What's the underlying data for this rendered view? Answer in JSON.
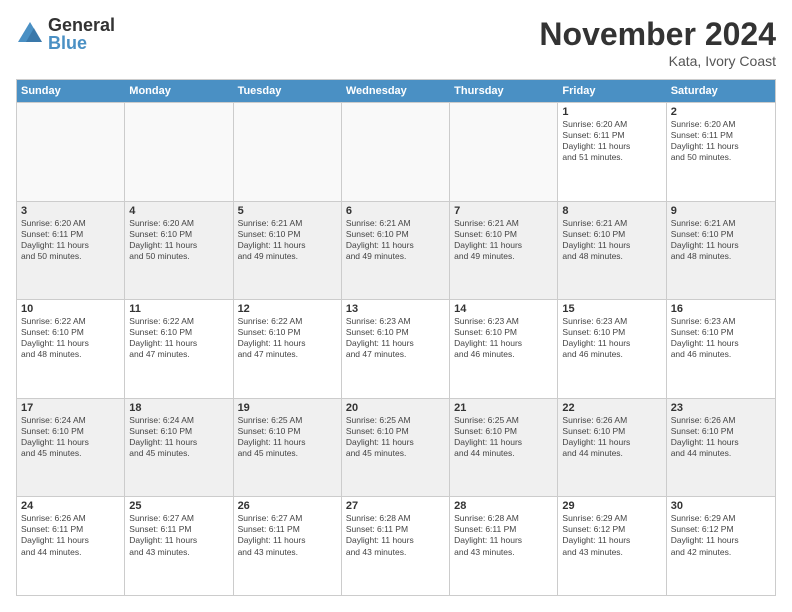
{
  "logo": {
    "general": "General",
    "blue": "Blue"
  },
  "title": "November 2024",
  "location": "Kata, Ivory Coast",
  "days_of_week": [
    "Sunday",
    "Monday",
    "Tuesday",
    "Wednesday",
    "Thursday",
    "Friday",
    "Saturday"
  ],
  "weeks": [
    [
      {
        "day": "",
        "info": "",
        "empty": true
      },
      {
        "day": "",
        "info": "",
        "empty": true
      },
      {
        "day": "",
        "info": "",
        "empty": true
      },
      {
        "day": "",
        "info": "",
        "empty": true
      },
      {
        "day": "",
        "info": "",
        "empty": true
      },
      {
        "day": "1",
        "info": "Sunrise: 6:20 AM\nSunset: 6:11 PM\nDaylight: 11 hours\nand 51 minutes."
      },
      {
        "day": "2",
        "info": "Sunrise: 6:20 AM\nSunset: 6:11 PM\nDaylight: 11 hours\nand 50 minutes."
      }
    ],
    [
      {
        "day": "3",
        "info": "Sunrise: 6:20 AM\nSunset: 6:11 PM\nDaylight: 11 hours\nand 50 minutes.",
        "shaded": true
      },
      {
        "day": "4",
        "info": "Sunrise: 6:20 AM\nSunset: 6:10 PM\nDaylight: 11 hours\nand 50 minutes.",
        "shaded": true
      },
      {
        "day": "5",
        "info": "Sunrise: 6:21 AM\nSunset: 6:10 PM\nDaylight: 11 hours\nand 49 minutes.",
        "shaded": true
      },
      {
        "day": "6",
        "info": "Sunrise: 6:21 AM\nSunset: 6:10 PM\nDaylight: 11 hours\nand 49 minutes.",
        "shaded": true
      },
      {
        "day": "7",
        "info": "Sunrise: 6:21 AM\nSunset: 6:10 PM\nDaylight: 11 hours\nand 49 minutes.",
        "shaded": true
      },
      {
        "day": "8",
        "info": "Sunrise: 6:21 AM\nSunset: 6:10 PM\nDaylight: 11 hours\nand 48 minutes.",
        "shaded": true
      },
      {
        "day": "9",
        "info": "Sunrise: 6:21 AM\nSunset: 6:10 PM\nDaylight: 11 hours\nand 48 minutes.",
        "shaded": true
      }
    ],
    [
      {
        "day": "10",
        "info": "Sunrise: 6:22 AM\nSunset: 6:10 PM\nDaylight: 11 hours\nand 48 minutes."
      },
      {
        "day": "11",
        "info": "Sunrise: 6:22 AM\nSunset: 6:10 PM\nDaylight: 11 hours\nand 47 minutes."
      },
      {
        "day": "12",
        "info": "Sunrise: 6:22 AM\nSunset: 6:10 PM\nDaylight: 11 hours\nand 47 minutes."
      },
      {
        "day": "13",
        "info": "Sunrise: 6:23 AM\nSunset: 6:10 PM\nDaylight: 11 hours\nand 47 minutes."
      },
      {
        "day": "14",
        "info": "Sunrise: 6:23 AM\nSunset: 6:10 PM\nDaylight: 11 hours\nand 46 minutes."
      },
      {
        "day": "15",
        "info": "Sunrise: 6:23 AM\nSunset: 6:10 PM\nDaylight: 11 hours\nand 46 minutes."
      },
      {
        "day": "16",
        "info": "Sunrise: 6:23 AM\nSunset: 6:10 PM\nDaylight: 11 hours\nand 46 minutes."
      }
    ],
    [
      {
        "day": "17",
        "info": "Sunrise: 6:24 AM\nSunset: 6:10 PM\nDaylight: 11 hours\nand 45 minutes.",
        "shaded": true
      },
      {
        "day": "18",
        "info": "Sunrise: 6:24 AM\nSunset: 6:10 PM\nDaylight: 11 hours\nand 45 minutes.",
        "shaded": true
      },
      {
        "day": "19",
        "info": "Sunrise: 6:25 AM\nSunset: 6:10 PM\nDaylight: 11 hours\nand 45 minutes.",
        "shaded": true
      },
      {
        "day": "20",
        "info": "Sunrise: 6:25 AM\nSunset: 6:10 PM\nDaylight: 11 hours\nand 45 minutes.",
        "shaded": true
      },
      {
        "day": "21",
        "info": "Sunrise: 6:25 AM\nSunset: 6:10 PM\nDaylight: 11 hours\nand 44 minutes.",
        "shaded": true
      },
      {
        "day": "22",
        "info": "Sunrise: 6:26 AM\nSunset: 6:10 PM\nDaylight: 11 hours\nand 44 minutes.",
        "shaded": true
      },
      {
        "day": "23",
        "info": "Sunrise: 6:26 AM\nSunset: 6:10 PM\nDaylight: 11 hours\nand 44 minutes.",
        "shaded": true
      }
    ],
    [
      {
        "day": "24",
        "info": "Sunrise: 6:26 AM\nSunset: 6:11 PM\nDaylight: 11 hours\nand 44 minutes."
      },
      {
        "day": "25",
        "info": "Sunrise: 6:27 AM\nSunset: 6:11 PM\nDaylight: 11 hours\nand 43 minutes."
      },
      {
        "day": "26",
        "info": "Sunrise: 6:27 AM\nSunset: 6:11 PM\nDaylight: 11 hours\nand 43 minutes."
      },
      {
        "day": "27",
        "info": "Sunrise: 6:28 AM\nSunset: 6:11 PM\nDaylight: 11 hours\nand 43 minutes."
      },
      {
        "day": "28",
        "info": "Sunrise: 6:28 AM\nSunset: 6:11 PM\nDaylight: 11 hours\nand 43 minutes."
      },
      {
        "day": "29",
        "info": "Sunrise: 6:29 AM\nSunset: 6:12 PM\nDaylight: 11 hours\nand 43 minutes."
      },
      {
        "day": "30",
        "info": "Sunrise: 6:29 AM\nSunset: 6:12 PM\nDaylight: 11 hours\nand 42 minutes."
      }
    ]
  ]
}
